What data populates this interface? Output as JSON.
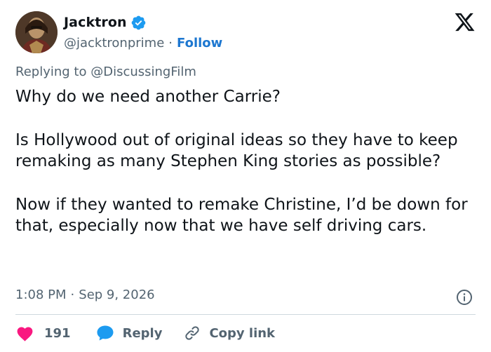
{
  "author": {
    "display_name": "Jacktron",
    "handle": "@jacktronprime",
    "separator": "·",
    "follow_label": "Follow",
    "verified": true
  },
  "reply_context": {
    "prefix": "Replying to",
    "mention": "@DiscussingFilm"
  },
  "tweet": {
    "paragraphs": [
      "Why do we need another Carrie?",
      "Is Hollywood out of original ideas so they have to keep remaking as many Stephen King stories as possible?",
      "Now if they wanted to remake Christine, I’d be down for that, especially now that we have self driving cars."
    ],
    "time": "1:08 PM",
    "separator": "·",
    "date": "Sep 9, 2026"
  },
  "actions": {
    "like_count": "191",
    "reply_label": "Reply",
    "copy_label": "Copy link"
  },
  "icons": {
    "brand": "x-logo-icon",
    "verified": "verified-badge-icon",
    "info": "info-icon",
    "like": "heart-icon",
    "reply": "speech-bubble-icon",
    "copy": "link-icon"
  },
  "colors": {
    "text": "#0f1419",
    "secondary": "#536471",
    "link": "#1d77d0",
    "verified": "#1d9bf0",
    "like": "#f91880",
    "divider": "#cfd9de"
  }
}
